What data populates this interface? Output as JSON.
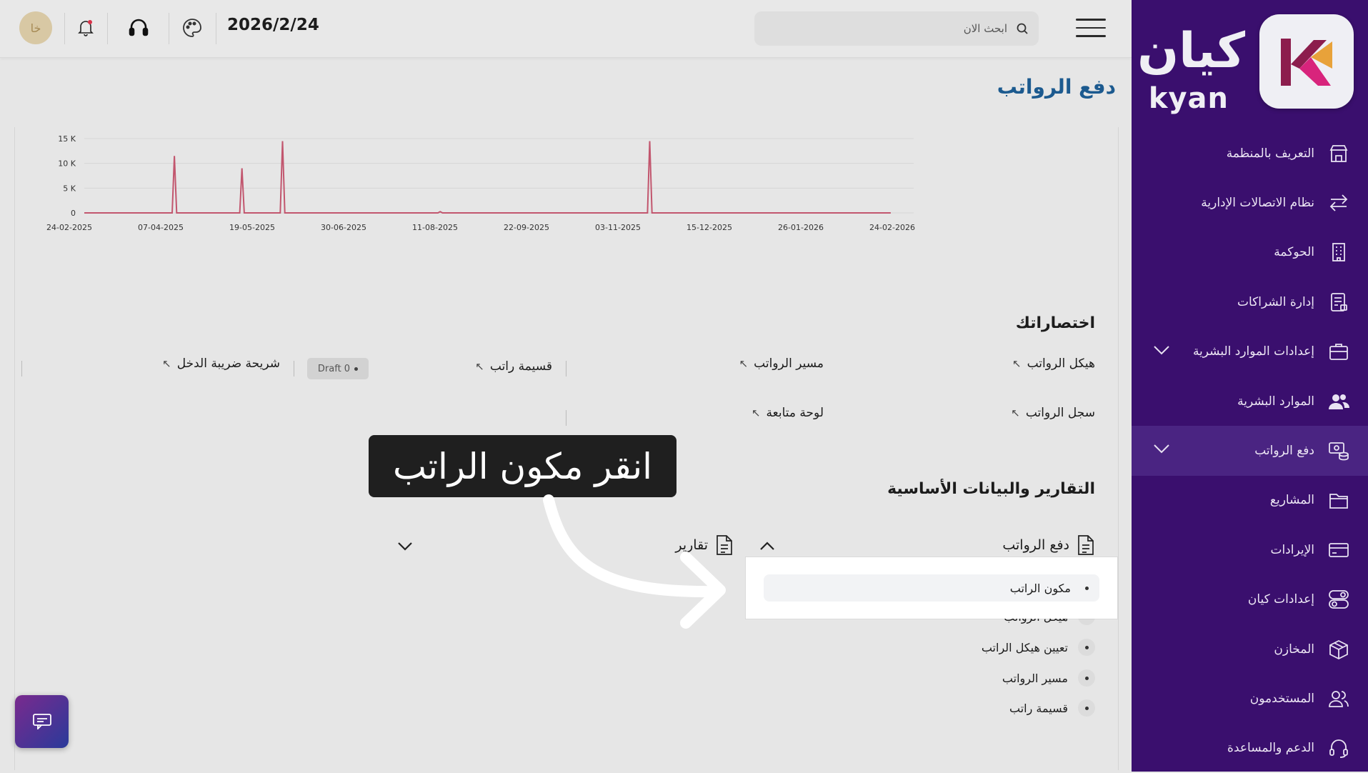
{
  "topbar": {
    "avatar_initials": "خا",
    "date": "2026/2/24",
    "search_placeholder": "ابحث الان"
  },
  "brand": {
    "name_ar": "كيان",
    "name_en": "kyan",
    "accent": "#3a0f6e"
  },
  "sidebar": {
    "items": [
      {
        "label": "التعريف بالمنظمة",
        "icon": "store-icon"
      },
      {
        "label": "نظام الاتصالات الإدارية",
        "icon": "arrows-exchange-icon"
      },
      {
        "label": "الحوكمة",
        "icon": "building-icon"
      },
      {
        "label": "إدارة الشراكات",
        "icon": "document-icon"
      },
      {
        "label": "إعدادات الموارد البشرية",
        "icon": "briefcase-icon"
      },
      {
        "label": "الموارد البشرية",
        "icon": "users-icon"
      },
      {
        "label": "دفع الرواتب",
        "icon": "money-icon"
      },
      {
        "label": "المشاريع",
        "icon": "folder-icon"
      },
      {
        "label": "الإيرادات",
        "icon": "card-icon"
      },
      {
        "label": "إعدادات كيان",
        "icon": "toggle-icon"
      },
      {
        "label": "المخازن",
        "icon": "box-icon"
      },
      {
        "label": "المستخدمون",
        "icon": "user-group-icon"
      },
      {
        "label": "الدعم والمساعدة",
        "icon": "headset-icon"
      }
    ]
  },
  "main": {
    "page_title": "دفع الرواتب",
    "shortcuts_title": "اختصاراتك",
    "shortcuts": [
      {
        "label": "هيكل الرواتب"
      },
      {
        "label": "مسير الرواتب"
      },
      {
        "label": "قسيمة راتب"
      },
      {
        "label": "شريحة ضريبة الدخل"
      },
      {
        "label": "سجل الرواتب"
      },
      {
        "label": "لوحة متابعة"
      }
    ],
    "draft_badge": "Draft 0",
    "reports_title": "التقارير والبيانات الأساسية",
    "accordion": {
      "payroll_label": "دفع الرواتب",
      "reports_label": "تقارير",
      "items": [
        "مكون الراتب",
        "هيكل الرواتب",
        "تعيين هيكل الراتب",
        "مسير الرواتب",
        "قسيمة راتب"
      ]
    }
  },
  "overlay": {
    "instruction": "انقر مكون الراتب"
  },
  "chart_data": {
    "type": "line",
    "title": "",
    "xlabel": "",
    "ylabel": "",
    "ylim": [
      0,
      15000
    ],
    "y_ticks": [
      "0",
      "5 K",
      "10 K",
      "15 K"
    ],
    "y_tick_values": [
      0,
      5000,
      10000,
      15000
    ],
    "x_ticks": [
      "24-02-2025",
      "07-04-2025",
      "19-05-2025",
      "30-06-2025",
      "11-08-2025",
      "22-09-2025",
      "03-11-2025",
      "15-12-2025",
      "26-01-2026",
      "24-02-2026"
    ],
    "grid": true,
    "line_color": "#c2566e",
    "series": [
      {
        "x": [
          "2025-02-24",
          "2025-04-04",
          "2025-04-05",
          "2025-04-06",
          "2025-05-04",
          "2025-05-05",
          "2025-05-06",
          "2025-05-22",
          "2025-05-23",
          "2025-05-24",
          "2025-07-31",
          "2025-08-01",
          "2025-08-02",
          "2025-11-01",
          "2025-11-02",
          "2025-11-03",
          "2026-02-17"
        ],
        "y": [
          0,
          0,
          11500,
          0,
          0,
          9000,
          0,
          0,
          14500,
          0,
          0,
          250,
          0,
          0,
          14500,
          0,
          0
        ]
      }
    ]
  }
}
